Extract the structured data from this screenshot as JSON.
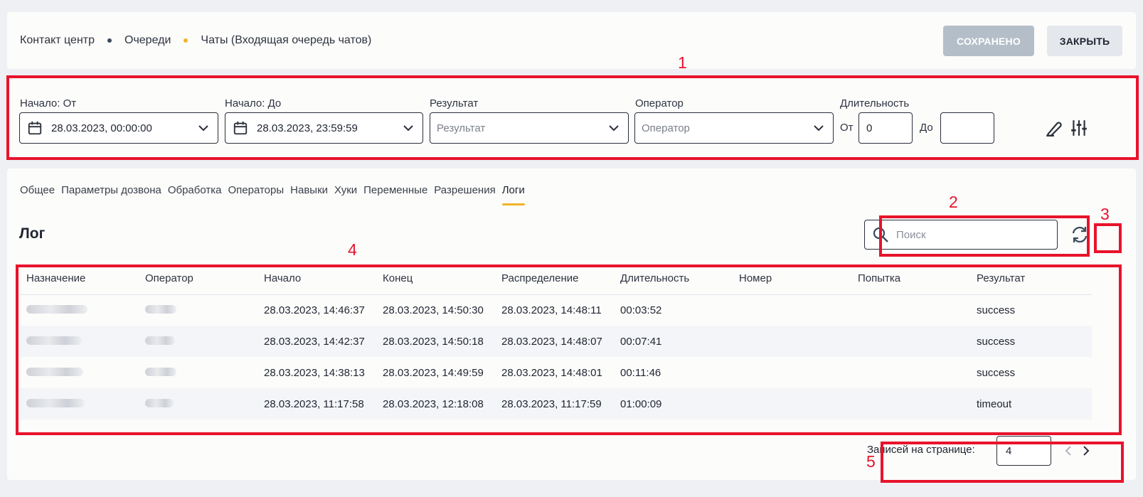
{
  "breadcrumb": {
    "items": [
      "Контакт центр",
      "Очереди",
      "Чаты (Входящая очередь чатов)"
    ],
    "separator_colors": [
      "#3b4a5c",
      "#f0b429"
    ]
  },
  "header": {
    "saved_label": "СОХРАНЕНО",
    "close_label": "ЗАКРЫТЬ"
  },
  "filters": {
    "start_from": {
      "label": "Начало: От",
      "value": "28.03.2023, 00:00:00"
    },
    "start_to": {
      "label": "Начало: До",
      "value": "28.03.2023, 23:59:59"
    },
    "result": {
      "label": "Результат",
      "placeholder": "Результат"
    },
    "operator": {
      "label": "Оператор",
      "placeholder": "Оператор"
    },
    "duration": {
      "label": "Длительность",
      "from_label": "От",
      "from_value": "0",
      "to_label": "До",
      "to_value": ""
    }
  },
  "tabs": [
    "Общее",
    "Параметры дозвона",
    "Обработка",
    "Операторы",
    "Навыки",
    "Хуки",
    "Переменные",
    "Разрешения",
    "Логи"
  ],
  "active_tab": 8,
  "log": {
    "title": "Лог",
    "search_placeholder": "Поиск",
    "columns": [
      "Назначение",
      "Оператор",
      "Начало",
      "Конец",
      "Распределение",
      "Длительность",
      "Номер",
      "Попытка",
      "Результат"
    ],
    "rows": [
      {
        "start": "28.03.2023, 14:46:37",
        "end": "28.03.2023, 14:50:30",
        "distribution": "28.03.2023, 14:48:11",
        "duration": "00:03:52",
        "number": "",
        "attempt": "",
        "result": "success"
      },
      {
        "start": "28.03.2023, 14:42:37",
        "end": "28.03.2023, 14:50:18",
        "distribution": "28.03.2023, 14:48:07",
        "duration": "00:07:41",
        "number": "",
        "attempt": "",
        "result": "success"
      },
      {
        "start": "28.03.2023, 14:38:13",
        "end": "28.03.2023, 14:49:59",
        "distribution": "28.03.2023, 14:48:01",
        "duration": "00:11:46",
        "number": "",
        "attempt": "",
        "result": "success"
      },
      {
        "start": "28.03.2023, 11:17:58",
        "end": "28.03.2023, 12:18:08",
        "distribution": "28.03.2023, 11:17:59",
        "duration": "01:00:09",
        "number": "",
        "attempt": "",
        "result": "timeout"
      }
    ]
  },
  "pagination": {
    "label": "Записей на странице:",
    "value": "4"
  },
  "annotations": [
    "1",
    "2",
    "3",
    "4",
    "5"
  ],
  "colors": {
    "annotation": "#e8132b",
    "tab_underline": "#f0b429",
    "saved_button": "#b4bec8"
  }
}
